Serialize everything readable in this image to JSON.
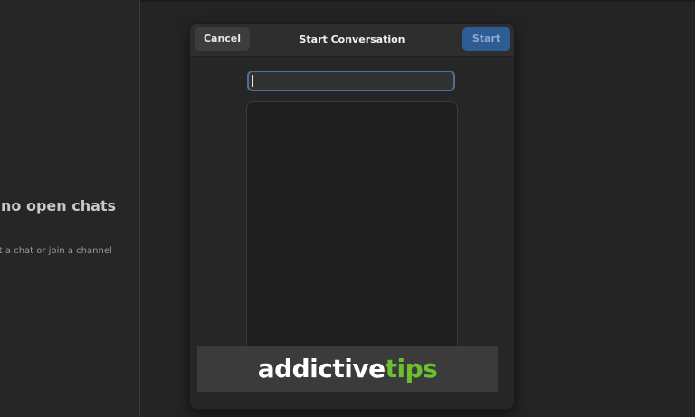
{
  "sidebar": {
    "empty_title": "have no open chats",
    "empty_subtitle": "to start a chat or join a channel"
  },
  "dialog": {
    "title": "Start Conversation",
    "cancel_label": "Cancel",
    "start_label": "Start",
    "search": {
      "value": "",
      "placeholder": ""
    }
  },
  "watermark": {
    "text_part1": "addictive",
    "text_part2": "tips"
  },
  "colors": {
    "accent": "#2e5c94",
    "input_focus": "#4f6f99",
    "watermark_green": "#6cbf2f"
  }
}
